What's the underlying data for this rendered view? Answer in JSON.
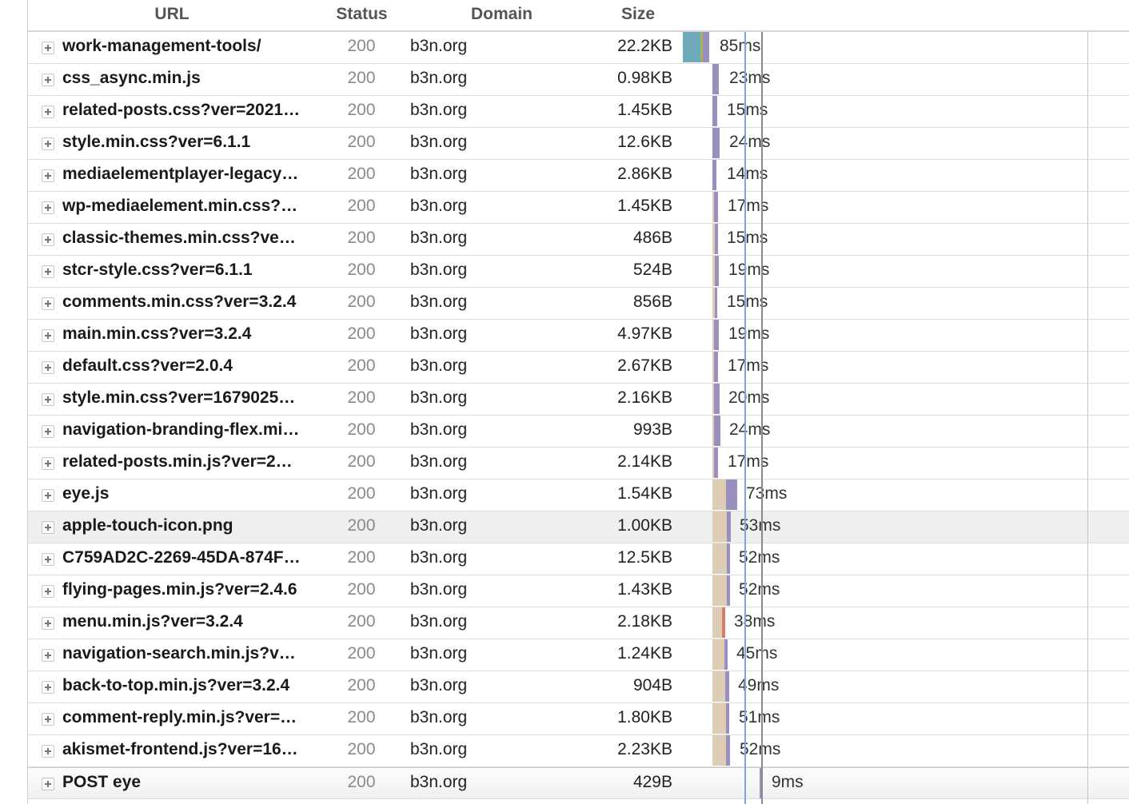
{
  "columns": {
    "url": "URL",
    "status": "Status",
    "domain": "Domain",
    "size": "Size"
  },
  "colors": {
    "waiting": "#9b8fbf",
    "blocked": "#dccdb4",
    "connect": "#6eaab9",
    "ssl": "#d49a4a",
    "dns": "#8cbf5e",
    "send": "#d97c6a",
    "dom_line": "#7aa7e0",
    "load_line": "#8a8a8a"
  },
  "requests": [
    {
      "url": "work-management-tools/",
      "status": "200",
      "domain": "b3n.org",
      "size": "22.2KB",
      "time": "85ms"
    },
    {
      "url": "css_async.min.js",
      "status": "200",
      "domain": "b3n.org",
      "size": "0.98KB",
      "time": "23ms"
    },
    {
      "url": "related-posts.css?ver=2021…",
      "status": "200",
      "domain": "b3n.org",
      "size": "1.45KB",
      "time": "15ms"
    },
    {
      "url": "style.min.css?ver=6.1.1",
      "status": "200",
      "domain": "b3n.org",
      "size": "12.6KB",
      "time": "24ms"
    },
    {
      "url": "mediaelementplayer-legacy…",
      "status": "200",
      "domain": "b3n.org",
      "size": "2.86KB",
      "time": "14ms"
    },
    {
      "url": "wp-mediaelement.min.css?…",
      "status": "200",
      "domain": "b3n.org",
      "size": "1.45KB",
      "time": "17ms"
    },
    {
      "url": "classic-themes.min.css?ve…",
      "status": "200",
      "domain": "b3n.org",
      "size": "486B",
      "time": "15ms"
    },
    {
      "url": "stcr-style.css?ver=6.1.1",
      "status": "200",
      "domain": "b3n.org",
      "size": "524B",
      "time": "19ms"
    },
    {
      "url": "comments.min.css?ver=3.2.4",
      "status": "200",
      "domain": "b3n.org",
      "size": "856B",
      "time": "15ms"
    },
    {
      "url": "main.min.css?ver=3.2.4",
      "status": "200",
      "domain": "b3n.org",
      "size": "4.97KB",
      "time": "19ms"
    },
    {
      "url": "default.css?ver=2.0.4",
      "status": "200",
      "domain": "b3n.org",
      "size": "2.67KB",
      "time": "17ms"
    },
    {
      "url": "style.min.css?ver=1679025…",
      "status": "200",
      "domain": "b3n.org",
      "size": "2.16KB",
      "time": "20ms"
    },
    {
      "url": "navigation-branding-flex.mi…",
      "status": "200",
      "domain": "b3n.org",
      "size": "993B",
      "time": "24ms"
    },
    {
      "url": "related-posts.min.js?ver=2…",
      "status": "200",
      "domain": "b3n.org",
      "size": "2.14KB",
      "time": "17ms"
    },
    {
      "url": "eye.js",
      "status": "200",
      "domain": "b3n.org",
      "size": "1.54KB",
      "time": "73ms"
    },
    {
      "url": "apple-touch-icon.png",
      "status": "200",
      "domain": "b3n.org",
      "size": "1.00KB",
      "time": "53ms"
    },
    {
      "url": "C759AD2C-2269-45DA-874F…",
      "status": "200",
      "domain": "b3n.org",
      "size": "12.5KB",
      "time": "52ms"
    },
    {
      "url": "flying-pages.min.js?ver=2.4.6",
      "status": "200",
      "domain": "b3n.org",
      "size": "1.43KB",
      "time": "52ms"
    },
    {
      "url": "menu.min.js?ver=3.2.4",
      "status": "200",
      "domain": "b3n.org",
      "size": "2.18KB",
      "time": "38ms"
    },
    {
      "url": "navigation-search.min.js?v…",
      "status": "200",
      "domain": "b3n.org",
      "size": "1.24KB",
      "time": "45ms"
    },
    {
      "url": "back-to-top.min.js?ver=3.2.4",
      "status": "200",
      "domain": "b3n.org",
      "size": "904B",
      "time": "49ms"
    },
    {
      "url": "comment-reply.min.js?ver=…",
      "status": "200",
      "domain": "b3n.org",
      "size": "1.80KB",
      "time": "51ms"
    },
    {
      "url": "akismet-frontend.js?ver=16…",
      "status": "200",
      "domain": "b3n.org",
      "size": "2.23KB",
      "time": "52ms"
    },
    {
      "url": "POST eye",
      "status": "200",
      "domain": "b3n.org",
      "size": "429B",
      "time": "9ms"
    }
  ]
}
